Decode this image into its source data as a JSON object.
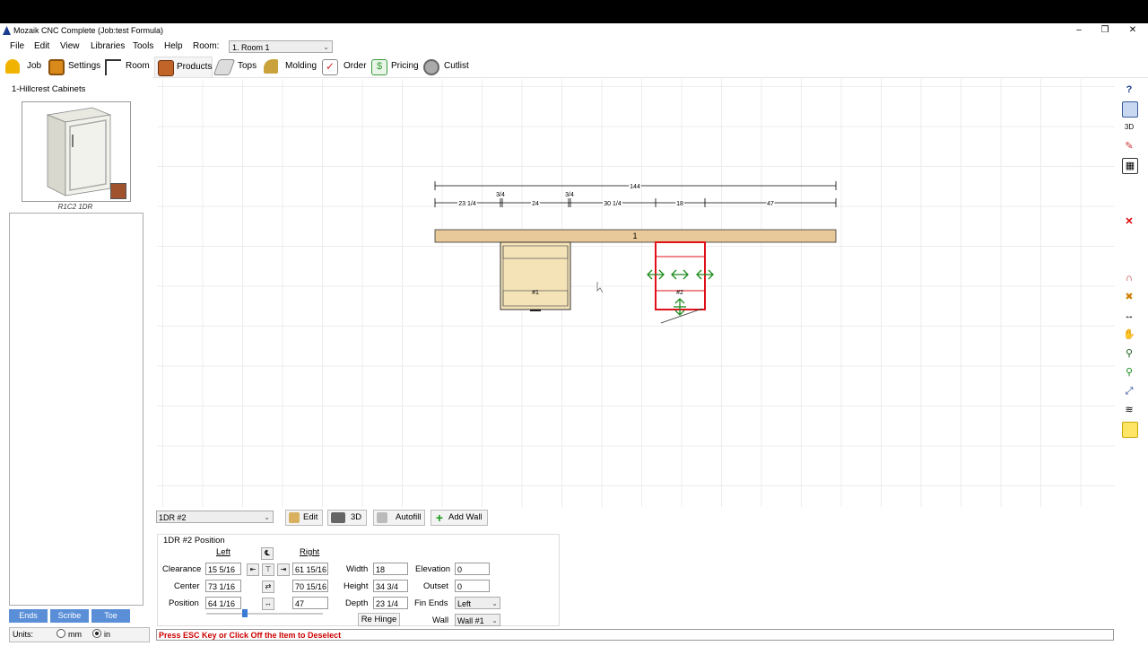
{
  "window": {
    "title": "Mozaik CNC Complete (Job:test Formula)"
  },
  "menu": {
    "items": [
      "File",
      "Edit",
      "View",
      "Libraries",
      "Tools",
      "Help"
    ],
    "room_label": "Room:",
    "room_value": "1. Room 1"
  },
  "tabs": [
    {
      "label": "Job",
      "icon": "hardhat-icon",
      "color": "#f0b400"
    },
    {
      "label": "Settings",
      "icon": "settings-icon",
      "color": "#d98a1a"
    },
    {
      "label": "Room",
      "icon": "room-icon",
      "color": "#333333"
    },
    {
      "label": "Products",
      "icon": "products-icon",
      "color": "#c0642a"
    },
    {
      "label": "Tops",
      "icon": "tops-icon",
      "color": "#999999"
    },
    {
      "label": "Molding",
      "icon": "molding-icon",
      "color": "#c9a23c"
    },
    {
      "label": "Order",
      "icon": "order-icon",
      "color": "#cc2a2a"
    },
    {
      "label": "Pricing",
      "icon": "pricing-icon",
      "color": "#3a9c3a"
    },
    {
      "label": "Cutlist",
      "icon": "cutlist-icon",
      "color": "#8a8a8a"
    }
  ],
  "left": {
    "library_title": "1-Hillcrest Cabinets",
    "thumb_caption": "R1C2 1DR",
    "buttons": [
      "Ends",
      "Scribe",
      "Toe"
    ],
    "units_label": "Units:",
    "unit_mm": "mm",
    "unit_in": "in",
    "units_selected": "in"
  },
  "drawing": {
    "total": "144",
    "dims": [
      "23 1/4",
      "3/4",
      "24",
      "3/4",
      "30 1/4",
      "18",
      "47"
    ],
    "wall_label": "1",
    "cab1": "#1",
    "cab2": "#2"
  },
  "bottom": {
    "product_value": "1DR #2",
    "edit_label": "Edit",
    "threed_label": "3D",
    "autofill_label": "Autofill",
    "addwall_label": "Add Wall"
  },
  "position": {
    "group_title": "1DR #2 Position",
    "left_header": "Left",
    "right_header": "Right",
    "rows": [
      {
        "label": "Clearance",
        "left": "15 5/16",
        "right": "61 15/16"
      },
      {
        "label": "Center",
        "left": "73 1/16",
        "right": "70 15/16"
      },
      {
        "label": "Position",
        "left": "64 1/16",
        "right": "47"
      }
    ],
    "width_label": "Width",
    "width": "18",
    "height_label": "Height",
    "height": "34 3/4",
    "depth_label": "Depth",
    "depth": "23 1/4",
    "rehinge_label": "Re Hinge",
    "elevation_label": "Elevation",
    "elevation": "0",
    "outset_label": "Outset",
    "outset": "0",
    "finends_label": "Fin Ends",
    "finends": "Left",
    "wall_label": "Wall",
    "wall": "Wall #1"
  },
  "status": "Press ESC Key or Click Off the Item to Deselect"
}
